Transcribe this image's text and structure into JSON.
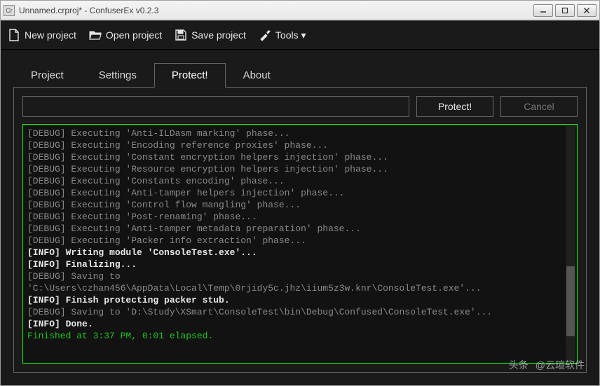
{
  "window": {
    "title": "Unnamed.crproj* - ConfuserEx v0.2.3",
    "icon_text": "Cr"
  },
  "toolbar": {
    "new_project": "New project",
    "open_project": "Open project",
    "save_project": "Save project",
    "tools": "Tools ▾"
  },
  "tabs": {
    "project": "Project",
    "settings": "Settings",
    "protect": "Protect!",
    "about": "About",
    "active": "protect"
  },
  "actions": {
    "protect": "Protect!",
    "cancel": "Cancel"
  },
  "log": [
    {
      "cls": "debug",
      "text": "[DEBUG] Executing 'Anti-ILDasm marking' phase..."
    },
    {
      "cls": "debug",
      "text": "[DEBUG] Executing 'Encoding reference proxies' phase..."
    },
    {
      "cls": "debug",
      "text": "[DEBUG] Executing 'Constant encryption helpers injection' phase..."
    },
    {
      "cls": "debug",
      "text": "[DEBUG] Executing 'Resource encryption helpers injection' phase..."
    },
    {
      "cls": "debug",
      "text": "[DEBUG] Executing 'Constants encoding' phase..."
    },
    {
      "cls": "debug",
      "text": "[DEBUG] Executing 'Anti-tamper helpers injection' phase..."
    },
    {
      "cls": "debug",
      "text": "[DEBUG] Executing 'Control flow mangling' phase..."
    },
    {
      "cls": "debug",
      "text": "[DEBUG] Executing 'Post-renaming' phase..."
    },
    {
      "cls": "debug",
      "text": "[DEBUG] Executing 'Anti-tamper metadata preparation' phase..."
    },
    {
      "cls": "debug",
      "text": "[DEBUG] Executing 'Packer info extraction' phase..."
    },
    {
      "cls": "info",
      "text": " [INFO] Writing module 'ConsoleTest.exe'..."
    },
    {
      "cls": "info",
      "text": " [INFO] Finalizing..."
    },
    {
      "cls": "debug",
      "text": "[DEBUG] Saving to 'C:\\Users\\czhan456\\AppData\\Local\\Temp\\0rjidy5c.jhz\\iium5z3w.knr\\ConsoleTest.exe'..."
    },
    {
      "cls": "info",
      "text": " [INFO] Finish protecting packer stub."
    },
    {
      "cls": "debug",
      "text": "[DEBUG] Saving to 'D:\\Study\\XSmart\\ConsoleTest\\bin\\Debug\\Confused\\ConsoleTest.exe'..."
    },
    {
      "cls": "info",
      "text": " [INFO] Done."
    },
    {
      "cls": "finished",
      "text": "Finished at 3:37 PM, 0:01 elapsed."
    }
  ],
  "watermark": {
    "left": "头条",
    "right": "@云瑄软件"
  }
}
